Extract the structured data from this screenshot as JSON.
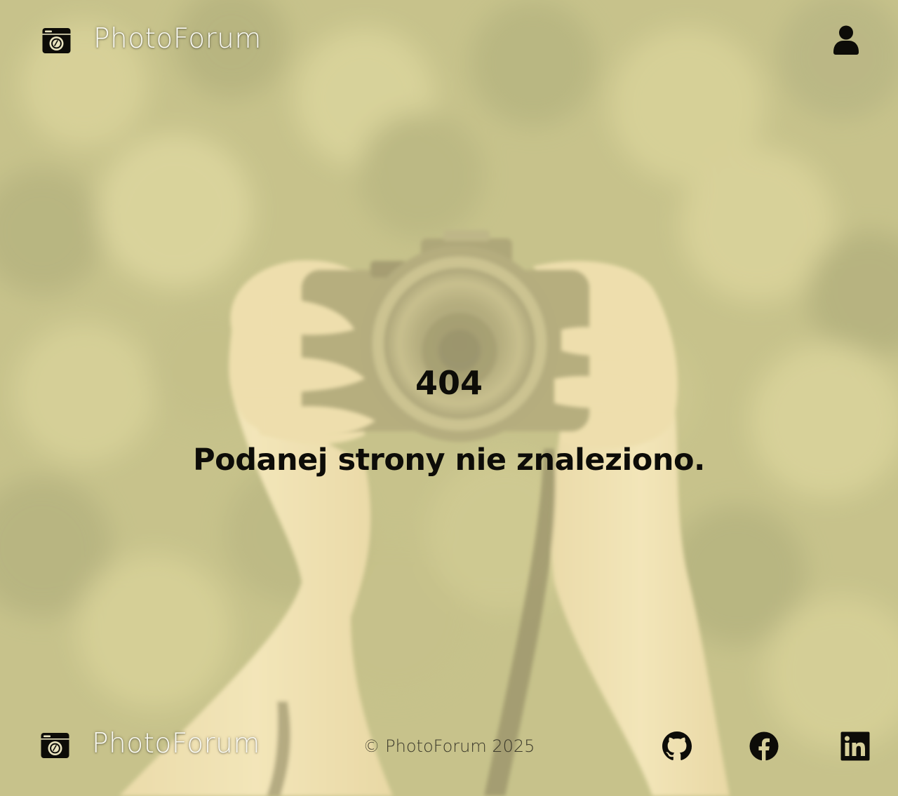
{
  "header": {
    "brand_name": "PhotoForum",
    "logo_icon": "camera-icon",
    "user_icon": "user-icon"
  },
  "main": {
    "error_code": "404",
    "error_message": "Podanej strony nie znaleziono."
  },
  "footer": {
    "brand_name": "PhotoForum",
    "copyright": "© PhotoForum 2025",
    "social_links": [
      {
        "name": "GitHub",
        "icon": "github-icon"
      },
      {
        "name": "Facebook",
        "icon": "facebook-icon"
      },
      {
        "name": "LinkedIn",
        "icon": "linkedin-icon"
      }
    ]
  },
  "colors": {
    "background_tint": "#d8d39a",
    "text_dark": "#0d0c08",
    "brand_text": "#fafaf3",
    "copyright_text": "#3c3a2b"
  }
}
